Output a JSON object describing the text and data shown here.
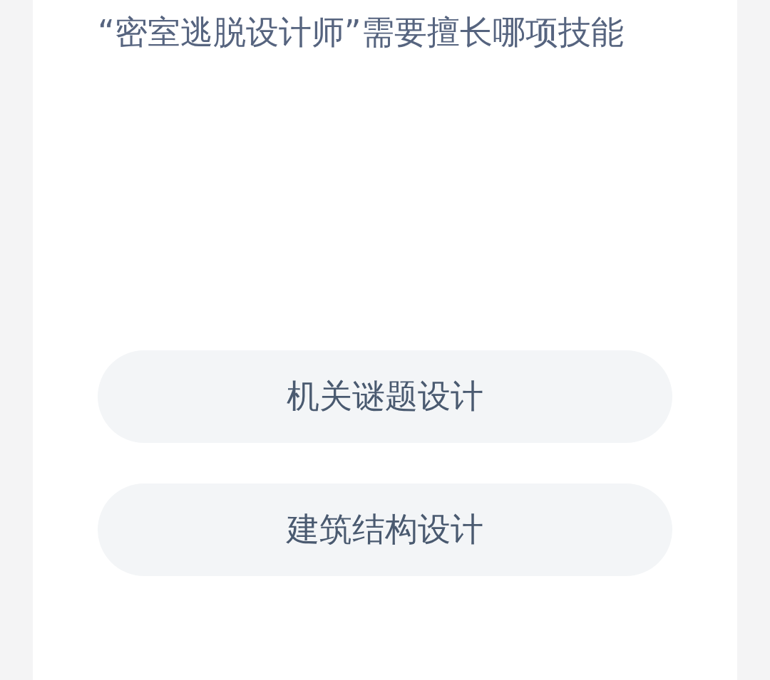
{
  "question": "“密室逃脱设计师”需要擅长哪项技能",
  "options": [
    {
      "label": "机关谜题设计"
    },
    {
      "label": "建筑结构设计"
    }
  ]
}
